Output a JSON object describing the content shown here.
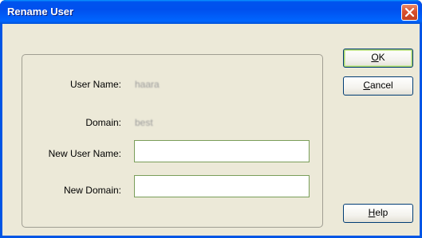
{
  "window": {
    "title": "Rename User"
  },
  "form": {
    "user_name_label": "User Name:",
    "user_name_value": "haara",
    "domain_label": "Domain:",
    "domain_value": "best",
    "new_user_name_label": "New User Name:",
    "new_user_name_value": "",
    "new_domain_label": "New Domain:",
    "new_domain_value": ""
  },
  "buttons": {
    "ok_accel": "O",
    "ok_rest": "K",
    "cancel_accel": "C",
    "cancel_rest": "ancel",
    "help_accel": "H",
    "help_rest": "elp"
  },
  "colors": {
    "title_bar": "#0054e3",
    "dialog_background": "#ece9d8",
    "close_button": "#d9502c"
  }
}
